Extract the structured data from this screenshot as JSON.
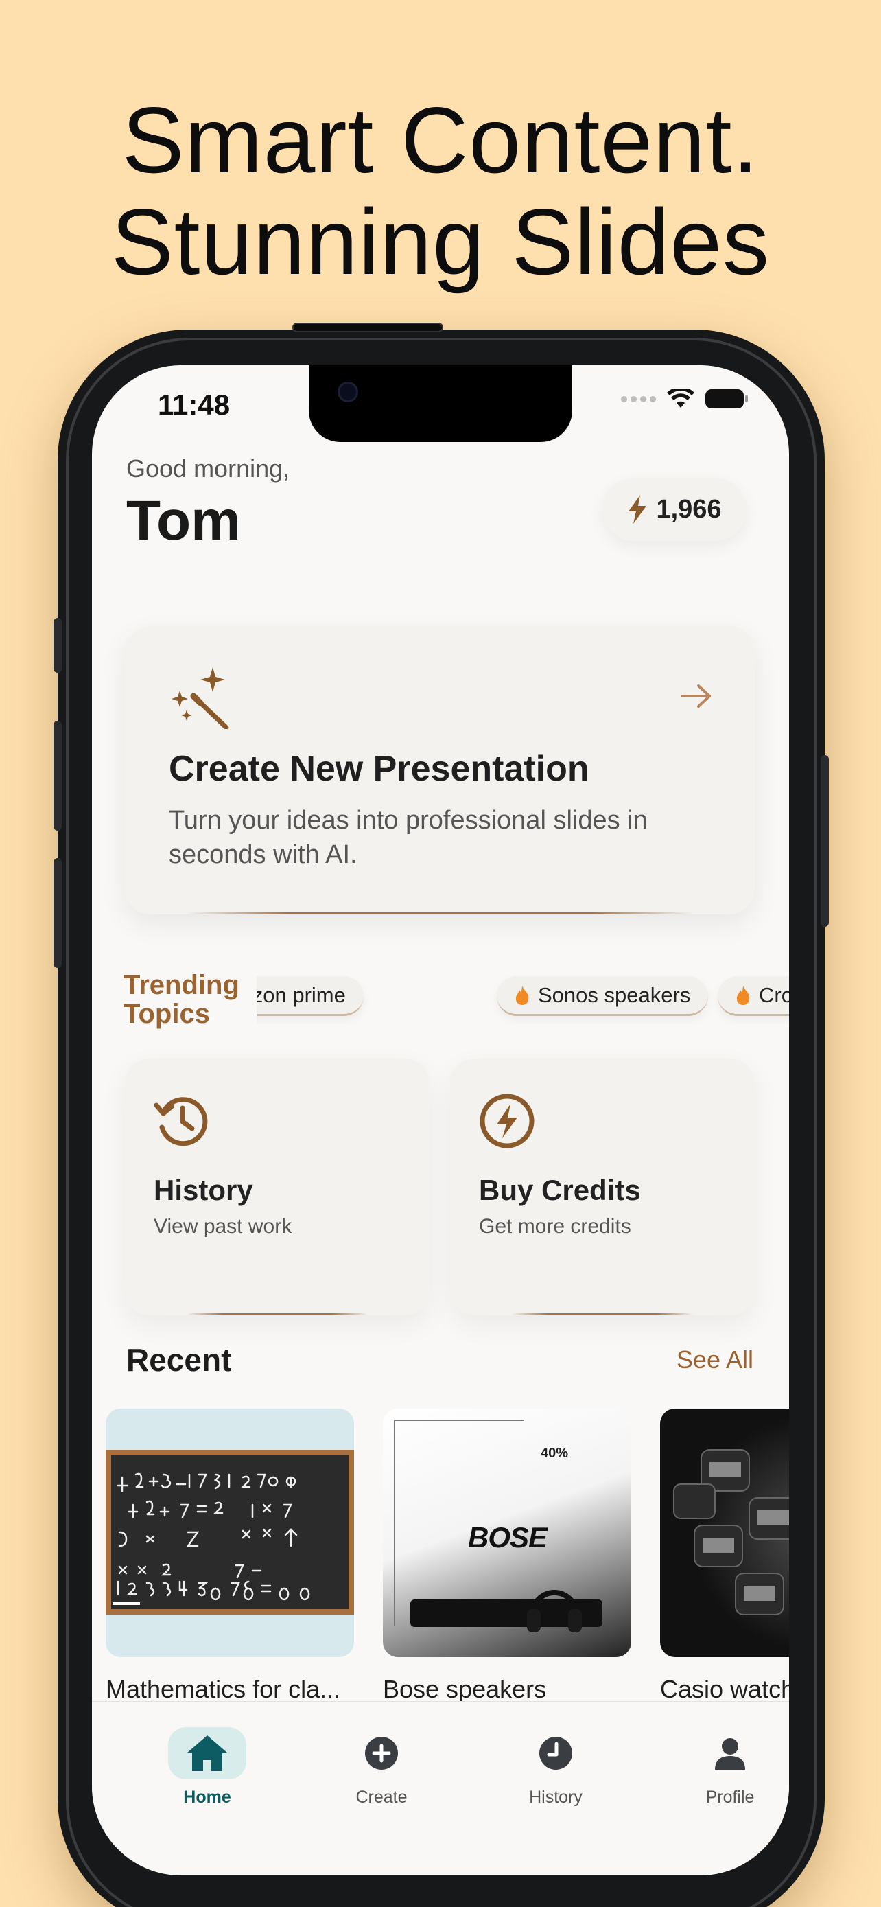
{
  "promo": {
    "headline_line1": "Smart Content.",
    "headline_line2": "Stunning Slides"
  },
  "status_bar": {
    "time": "11:48"
  },
  "header": {
    "greeting": "Good morning,",
    "user_name": "Tom",
    "credits": "1,966",
    "credits_icon": "bolt-icon"
  },
  "create_card": {
    "title": "Create New Presentation",
    "description": "Turn your ideas into professional slides in seconds with AI.",
    "icon": "magic-wand-icon"
  },
  "trending": {
    "label": "Trending Topics",
    "chips": [
      "Amazon prime",
      "Sonos speakers",
      "Crochet"
    ]
  },
  "quick_actions": [
    {
      "title": "History",
      "subtitle": "View past work",
      "icon": "history-icon"
    },
    {
      "title": "Buy Credits",
      "subtitle": "Get more credits",
      "icon": "bolt-circle-icon"
    }
  ],
  "recent": {
    "title": "Recent",
    "see_all": "See All",
    "items": [
      {
        "name": "Mathematics for cla..."
      },
      {
        "name": "Bose speakers",
        "thumb_text": "BOSE",
        "thumb_badge": "40%"
      },
      {
        "name": "Casio watch"
      }
    ]
  },
  "tabbar": {
    "tabs": [
      {
        "label": "Home",
        "icon": "home-icon",
        "active": true
      },
      {
        "label": "Create",
        "icon": "plus-circle-icon"
      },
      {
        "label": "History",
        "icon": "clock-icon"
      },
      {
        "label": "Profile",
        "icon": "person-icon"
      }
    ]
  },
  "colors": {
    "background": "#FEE0AE",
    "accent_brown": "#9A6330",
    "active_tab": "#0E5C63"
  }
}
